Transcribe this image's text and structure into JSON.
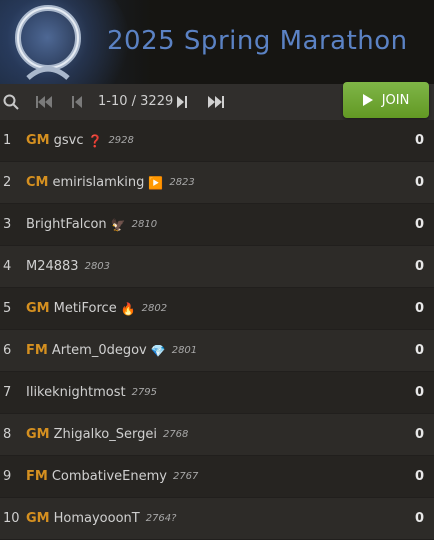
{
  "header": {
    "title": "2025 Spring Marathon"
  },
  "controls": {
    "pager_text": "1-10 / 3229",
    "join_label": "JOIN"
  },
  "colors": {
    "accent_title": "#5b82c4",
    "join_green": "#629924",
    "gm_gold": "#d59020"
  },
  "players": [
    {
      "rank": "1",
      "title": "GM",
      "name": "gsvc",
      "flag": "❓",
      "rating": "2928",
      "score": "0"
    },
    {
      "rank": "2",
      "title": "CM",
      "name": "emirislamking",
      "flag": "▶️",
      "rating": "2823",
      "score": "0"
    },
    {
      "rank": "3",
      "title": "",
      "name": "BrightFalcon",
      "flag": "🦅",
      "rating": "2810",
      "score": "0"
    },
    {
      "rank": "4",
      "title": "",
      "name": "M24883",
      "flag": "",
      "rating": "2803",
      "score": "0"
    },
    {
      "rank": "5",
      "title": "GM",
      "name": "MetiForce",
      "flag": "🔥",
      "rating": "2802",
      "score": "0"
    },
    {
      "rank": "6",
      "title": "FM",
      "name": "Artem_0degov",
      "flag": "💎",
      "rating": "2801",
      "score": "0"
    },
    {
      "rank": "7",
      "title": "",
      "name": "Ilikeknightmost",
      "flag": "",
      "rating": "2795",
      "score": "0"
    },
    {
      "rank": "8",
      "title": "GM",
      "name": "Zhigalko_Sergei",
      "flag": "",
      "rating": "2768",
      "score": "0"
    },
    {
      "rank": "9",
      "title": "FM",
      "name": "CombativeEnemy",
      "flag": "",
      "rating": "2767",
      "score": "0"
    },
    {
      "rank": "10",
      "title": "GM",
      "name": "HomayooonT",
      "flag": "",
      "rating": "2764?",
      "score": "0"
    }
  ]
}
